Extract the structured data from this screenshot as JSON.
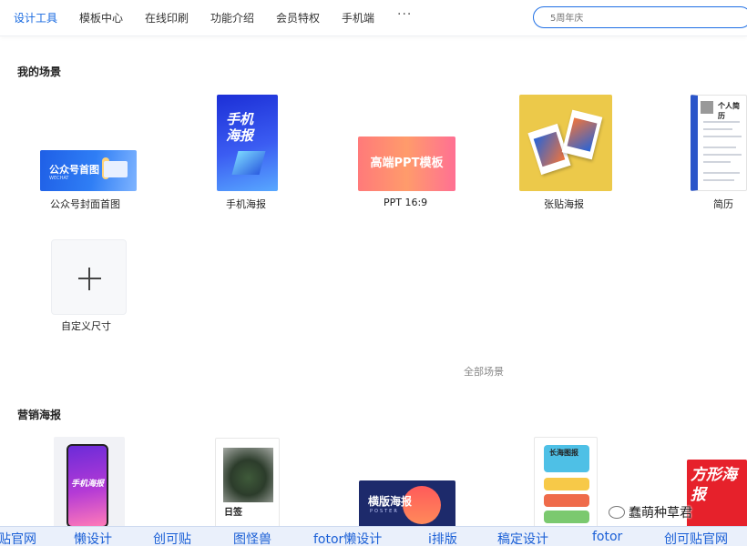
{
  "topnav": {
    "items": [
      {
        "label": "设计工具",
        "active": true
      },
      {
        "label": "模板中心",
        "active": false
      },
      {
        "label": "在线印刷",
        "active": false
      },
      {
        "label": "功能介绍",
        "active": false
      },
      {
        "label": "会员特权",
        "active": false
      },
      {
        "label": "手机端",
        "active": false
      }
    ],
    "more": "···",
    "search_placeholder": "5周年庆"
  },
  "scenes": {
    "title": "我的场景",
    "items": [
      {
        "label": "公众号封面首图",
        "thumb_title": "公众号首图",
        "thumb_subtitle": "WECHAT"
      },
      {
        "label": "手机海报",
        "thumb_title": "手机海报"
      },
      {
        "label": "PPT 16:9",
        "thumb_title": "高端PPT模板"
      },
      {
        "label": "张贴海报"
      },
      {
        "label": "简历",
        "thumb_title": "个人简历"
      }
    ],
    "custom_label": "自定义尺寸",
    "all_link": "全部场景"
  },
  "marketing": {
    "title": "营销海报",
    "items": [
      {
        "text": "手机海报"
      },
      {
        "text": "日签"
      },
      {
        "text": "横版海报",
        "subtext": "POSTER"
      },
      {
        "text": "长海图报"
      },
      {
        "text": "方形海报"
      }
    ]
  },
  "watermark": "蠢萌种草君",
  "link_bar": [
    "贴官网",
    "懒设计",
    "创可贴",
    "图怪兽",
    "fotor懒设计",
    "i排版",
    "稿定设计",
    "fotor",
    "创可贴官网"
  ],
  "colors": {
    "accent": "#1769e0"
  }
}
